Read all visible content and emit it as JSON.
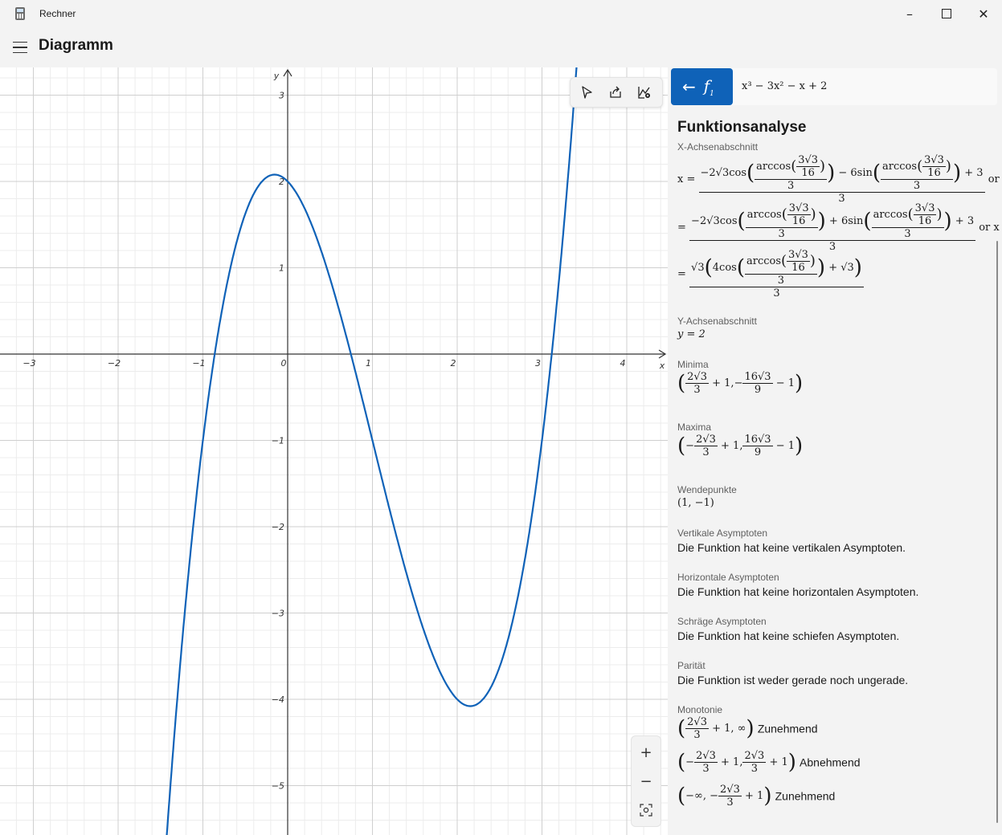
{
  "window": {
    "title": "Rechner"
  },
  "header": {
    "title": "Diagramm"
  },
  "graph": {
    "x_ticks": [
      "−3",
      "−2",
      "−1",
      "0",
      "1",
      "2",
      "3",
      "4"
    ],
    "y_ticks": [
      "3",
      "2",
      "1",
      "−1",
      "−2",
      "−3",
      "−4",
      "−5"
    ],
    "x_axis_label": "x",
    "y_axis_label": "y",
    "curve_color": "#0f62b8"
  },
  "chart_data": {
    "type": "line",
    "title": "",
    "xlabel": "x",
    "ylabel": "y",
    "xlim": [
      -3.35,
      4.45
    ],
    "ylim": [
      -5.55,
      3.3
    ],
    "grid": true,
    "series": [
      {
        "expression": "x^3 - 3x^2 - x + 2",
        "x": [
          -1.4,
          -1.2,
          -1.0,
          -0.8,
          -0.6,
          -0.4,
          -0.2,
          0,
          0.2,
          0.4,
          0.6,
          0.8,
          1.0,
          1.2,
          1.4,
          1.6,
          1.8,
          2.0,
          2.2,
          2.4,
          2.6,
          2.8,
          3.0,
          3.2,
          3.4
        ],
        "y": [
          -5.224,
          -2.848,
          -1.0,
          0.368,
          1.304,
          1.856,
          2.072,
          2.0,
          1.688,
          1.184,
          0.536,
          -0.208,
          -1.0,
          -1.792,
          -2.536,
          -3.184,
          -3.688,
          -4.0,
          -4.072,
          -3.856,
          -3.304,
          -2.368,
          -1.0,
          0.848,
          3.224
        ]
      }
    ]
  },
  "function_bar": {
    "function_name": "f",
    "function_index": "1",
    "expression": "x³ − 3x² − x + 2"
  },
  "analysis": {
    "title": "Funktionsanalyse",
    "x_intercept_label": "X-Achsenabschnitt",
    "x_intercept": {
      "lead": "x =",
      "sep": "or x",
      "eq": "=",
      "r1_num_a": "−2√3cos",
      "r1_mid": "− 6sin",
      "r1_tail": "+ 3",
      "r2_num_a": "−2√3cos",
      "r2_mid": "+ 6sin",
      "r2_tail": "+ 3",
      "r3_a": "√3",
      "r3_b": "4cos",
      "r3_tail": "+ √3",
      "arccos": "arccos",
      "inner_num": "3√3",
      "inner_den": "16",
      "three": "3"
    },
    "y_intercept_label": "Y-Achsenabschnitt",
    "y_intercept": "y = 2",
    "minima_label": "Minima",
    "maxima_label": "Maxima",
    "ext": {
      "two_sqrt3": "2√3",
      "three": "3",
      "plus_one": "+ 1,",
      "sixteen_sqrt3": "16√3",
      "nine": "9",
      "minus_one": "− 1",
      "minus": "−"
    },
    "inflection_label": "Wendepunkte",
    "inflection": "(1, −1)",
    "vertical_label": "Vertikale Asymptoten",
    "vertical": "Die Funktion hat keine vertikalen Asymptoten.",
    "horizontal_label": "Horizontale Asymptoten",
    "horizontal": "Die Funktion hat keine horizontalen Asymptoten.",
    "oblique_label": "Schräge Asymptoten",
    "oblique": "Die Funktion hat keine schiefen Asymptoten.",
    "parity_label": "Parität",
    "parity": "Die Funktion ist weder gerade noch ungerade.",
    "monotony_label": "Monotonie",
    "mono": {
      "plus_one_inf": "+ 1, ∞",
      "plus_one": "+ 1",
      "plus_one_comma": "+ 1,",
      "neg_inf": "−∞, −",
      "minus": "−"
    },
    "mono_words": [
      "Zunehmend",
      "Abnehmend",
      "Zunehmend"
    ]
  }
}
